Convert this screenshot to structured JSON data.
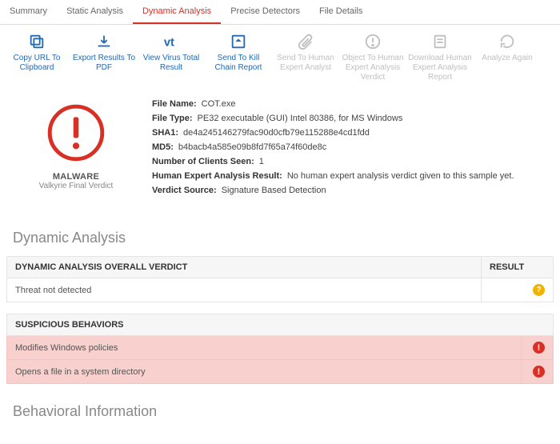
{
  "tabs": [
    {
      "label": "Summary"
    },
    {
      "label": "Static Analysis"
    },
    {
      "label": "Dynamic Analysis",
      "active": true
    },
    {
      "label": "Precise Detectors"
    },
    {
      "label": "File Details"
    }
  ],
  "toolbar": [
    {
      "id": "copy-url",
      "label": "Copy URL To Clipboard",
      "icon": "copy",
      "enabled": true
    },
    {
      "id": "export-pdf",
      "label": "Export Results To PDF",
      "icon": "download",
      "enabled": true
    },
    {
      "id": "vt",
      "label": "View Virus Total Result",
      "icon": "vt",
      "enabled": true
    },
    {
      "id": "killchain",
      "label": "Send To Kill Chain Report",
      "icon": "send",
      "enabled": true
    },
    {
      "id": "send-human",
      "label": "Send To Human Expert Analyst",
      "icon": "attach",
      "enabled": false
    },
    {
      "id": "object",
      "label": "Object To Human Expert Analysis Verdict",
      "icon": "alert",
      "enabled": false
    },
    {
      "id": "dl-report",
      "label": "Download Human Expert Analysis Report",
      "icon": "report",
      "enabled": false
    },
    {
      "id": "again",
      "label": "Analyze Again",
      "icon": "refresh",
      "enabled": false
    }
  ],
  "verdict": {
    "name": "MALWARE",
    "sub": "Valkyrie Final Verdict"
  },
  "file": {
    "name_label": "File Name:",
    "name": "COT.exe",
    "type_label": "File Type:",
    "type": "PE32 executable (GUI) Intel 80386, for MS Windows",
    "sha1_label": "SHA1:",
    "sha1": "de4a245146279fac90d0cfb79e115288e4cd1fdd",
    "md5_label": "MD5:",
    "md5": "b4bacb4a585e09b8fd7f65a74f60de8c",
    "clients_label": "Number of Clients Seen:",
    "clients": "1",
    "hear_label": "Human Expert Analysis Result:",
    "hear": "No human expert analysis verdict given to this sample yet.",
    "source_label": "Verdict Source:",
    "source": "Signature Based Detection"
  },
  "dyn": {
    "title": "Dynamic Analysis",
    "overall_h1": "DYNAMIC ANALYSIS OVERALL VERDICT",
    "overall_h2": "RESULT",
    "overall_row": "Threat not detected",
    "susp_title": "SUSPICIOUS BEHAVIORS",
    "susp_rows": [
      "Modifies Windows policies",
      "Opens a file in a system directory"
    ]
  },
  "behavioral_title": "Behavioral Information"
}
